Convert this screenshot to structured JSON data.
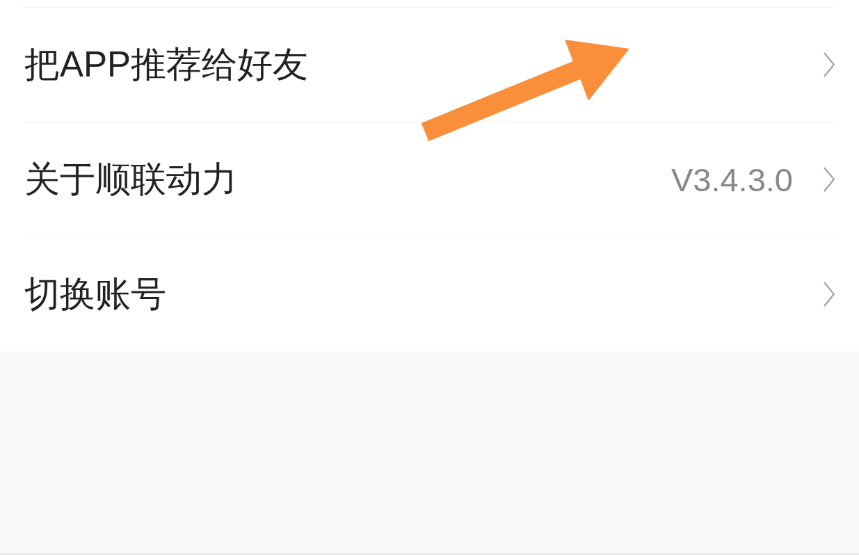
{
  "menu": {
    "items": [
      {
        "label": "把APP推荐给好友"
      },
      {
        "label": "关于顺联动力",
        "value": "V3.4.3.0"
      },
      {
        "label": "切换账号"
      }
    ]
  }
}
